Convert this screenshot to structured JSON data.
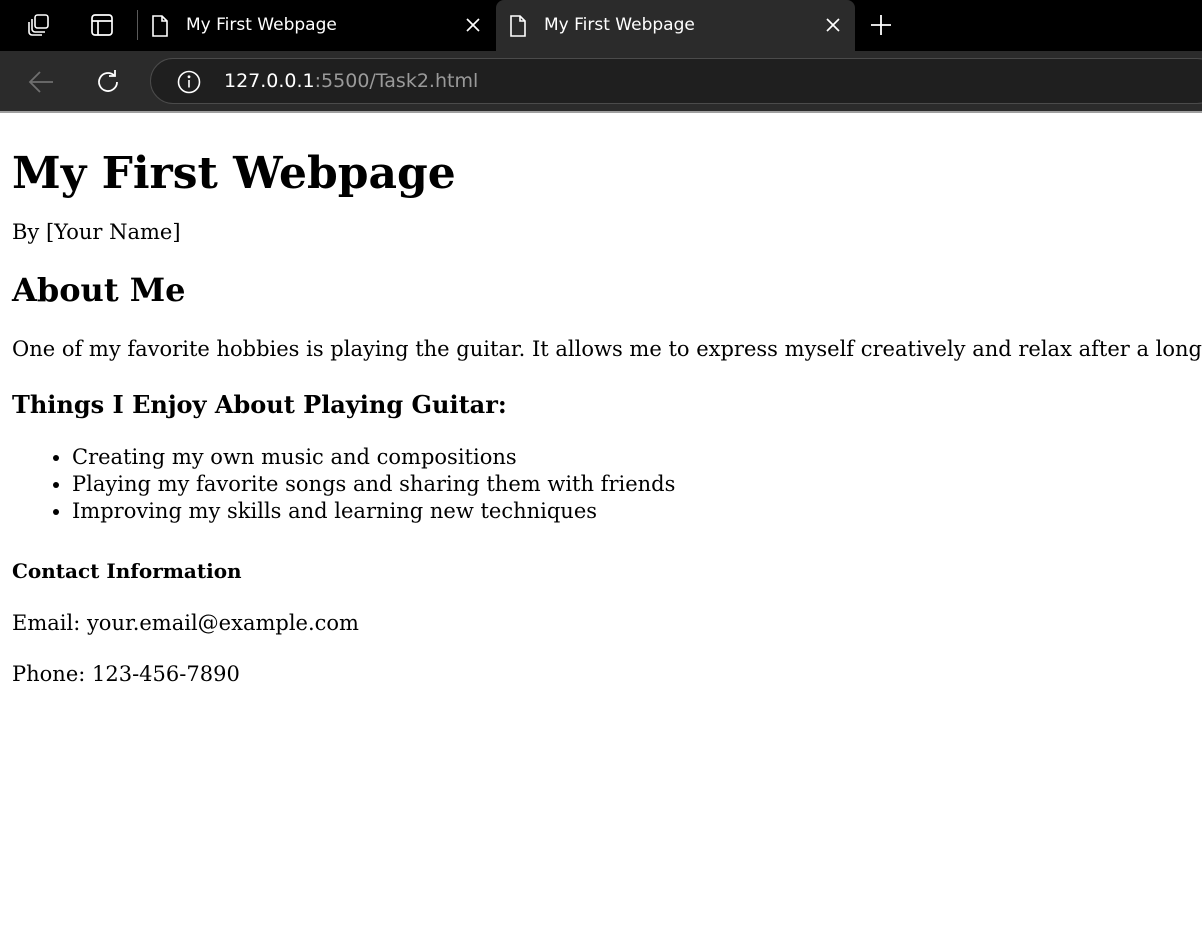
{
  "browser": {
    "tabs": [
      {
        "title": "My First Webpage",
        "active": false
      },
      {
        "title": "My First Webpage",
        "active": true
      }
    ],
    "address": {
      "host": "127.0.0.1",
      "path": ":5500/Task2.html"
    },
    "colors": {
      "tabbar_bg": "#000000",
      "active_tab_bg": "#2b2b2b",
      "url_host": "#ffffff",
      "url_path": "#9a9a9a"
    },
    "icons": [
      "workspaces-icon",
      "vertical-tabs-icon",
      "page-icon",
      "close-icon",
      "plus-icon",
      "back-arrow-icon",
      "refresh-icon",
      "info-icon"
    ]
  },
  "page": {
    "title": "My First Webpage",
    "byline": "By [Your Name]",
    "about_heading": "About Me",
    "about_text": "One of my favorite hobbies is playing the guitar. It allows me to express myself creatively and relax after a long day.",
    "enjoy_heading": "Things I Enjoy About Playing Guitar:",
    "enjoy_items": [
      "Creating my own music and compositions",
      "Playing my favorite songs and sharing them with friends",
      "Improving my skills and learning new techniques"
    ],
    "contact_heading": "Contact Information",
    "email": "Email: your.email@example.com",
    "phone": "Phone: 123-456-7890"
  }
}
